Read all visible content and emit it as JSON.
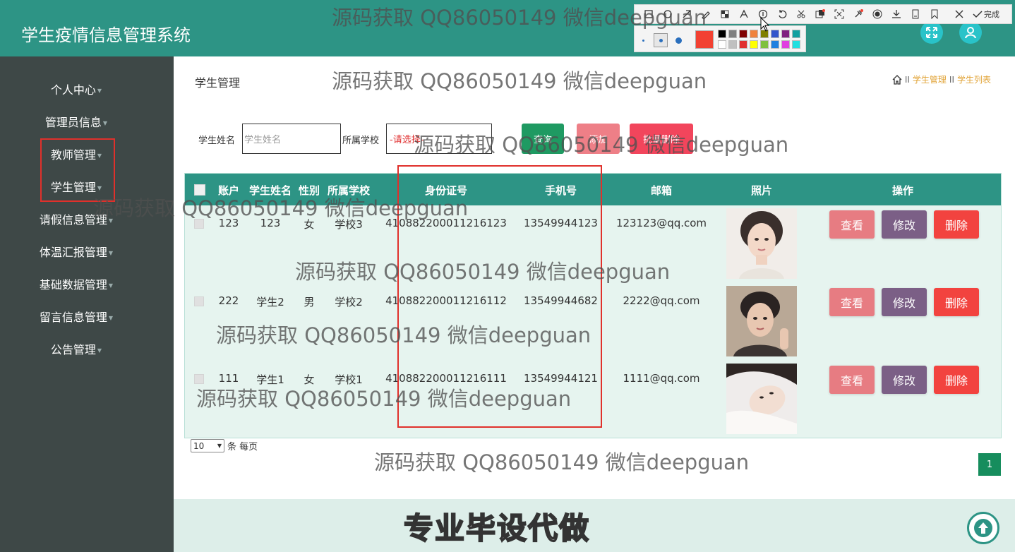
{
  "header": {
    "app_title": "学生疫情信息管理系统",
    "fullscreen_icon": "expand-arrows-icon",
    "user_icon": "user-icon"
  },
  "snip_toolbar": {
    "tools": [
      "rectangle-icon",
      "ellipse-icon",
      "arrow-icon",
      "pen-icon",
      "mosaic-icon",
      "text-icon",
      "number-icon",
      "undo-icon",
      "scissors-icon",
      "ocr-icon",
      "capture-icon",
      "pin-icon",
      "record-icon",
      "download-icon",
      "save-icon",
      "bookmark-icon",
      "close-icon"
    ],
    "done_label": "完成",
    "colors": [
      "#000000",
      "#808080",
      "#800000",
      "#f0823c",
      "#808000",
      "#3355cc",
      "#802080",
      "#10a0a0",
      "#ffffff",
      "#c0c0c0",
      "#e03030",
      "#ffff00",
      "#80c040",
      "#2080e0",
      "#e040e0",
      "#20e0e0"
    ],
    "current_color": "#f24132"
  },
  "sidebar": {
    "items": [
      {
        "label": "个人中心"
      },
      {
        "label": "管理员信息"
      },
      {
        "label": "教师管理"
      },
      {
        "label": "学生管理"
      },
      {
        "label": "请假信息管理"
      },
      {
        "label": "体温汇报管理"
      },
      {
        "label": "基础数据管理"
      },
      {
        "label": "留言信息管理"
      },
      {
        "label": "公告管理"
      }
    ]
  },
  "main": {
    "page_title": "学生管理",
    "breadcrumb": {
      "home_icon": "home-icon",
      "sep": "II",
      "crumb1": "学生管理",
      "crumb2": "学生列表"
    },
    "filter": {
      "name_label": "学生姓名",
      "name_placeholder": "学生姓名",
      "school_label": "所属学校",
      "school_value": "-请选择-",
      "query_label": "查询",
      "add_label": "添加",
      "batch_delete_label": "批量删除"
    },
    "table": {
      "columns": [
        "账户",
        "学生姓名",
        "性别",
        "所属学校",
        "身份证号",
        "手机号",
        "邮箱",
        "照片",
        "操作"
      ],
      "rows": [
        {
          "account": "123",
          "name": "123",
          "gender": "女",
          "school": "学校3",
          "id_card": "410882200011216123",
          "phone": "13549944123",
          "email": "123123@qq.com"
        },
        {
          "account": "222",
          "name": "学生2",
          "gender": "男",
          "school": "学校2",
          "id_card": "410882200011216112",
          "phone": "13549944682",
          "email": "2222@qq.com"
        },
        {
          "account": "111",
          "name": "学生1",
          "gender": "女",
          "school": "学校1",
          "id_card": "410882200011216111",
          "phone": "13549944121",
          "email": "1111@qq.com"
        }
      ],
      "actions": {
        "view": "查看",
        "edit": "修改",
        "delete": "删除"
      }
    },
    "pagination": {
      "page_size": "10",
      "per_page_label": "条 每页",
      "current_page": "1"
    },
    "footer_text": "专业毕设代做"
  },
  "watermark": "源码获取 QQ86050149 微信deepguan"
}
